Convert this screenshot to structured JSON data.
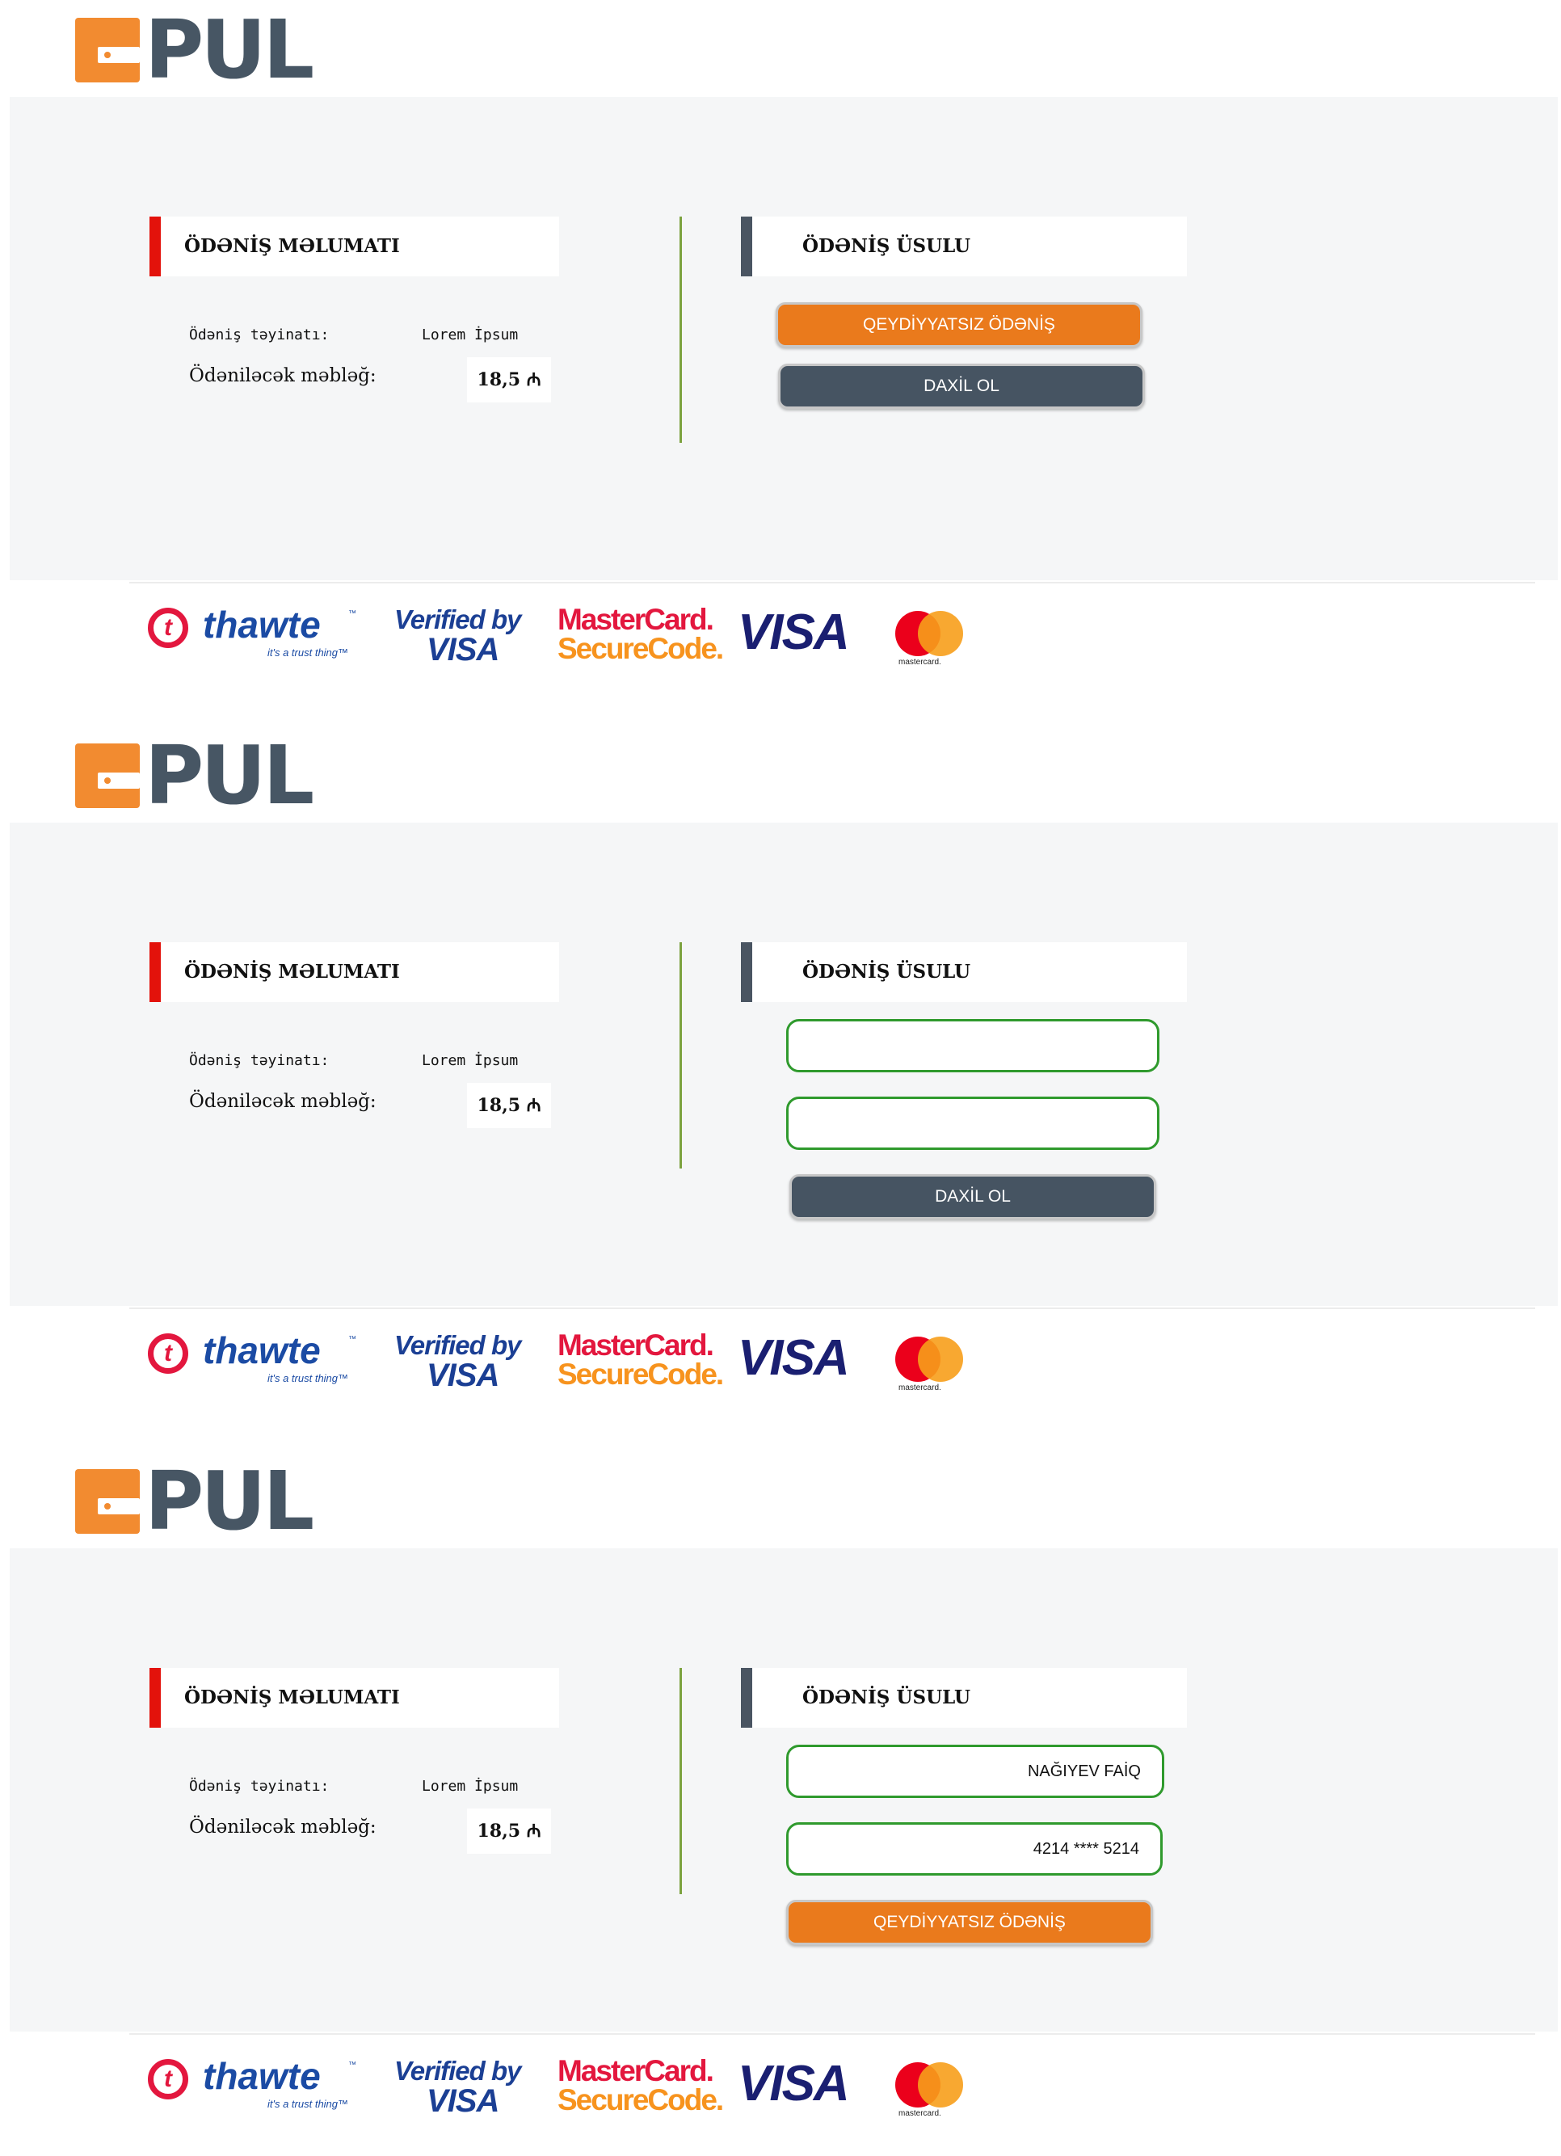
{
  "brand": {
    "logo_text": "PUL",
    "accent": "#f28b30",
    "dark": "#475664"
  },
  "payment_info": {
    "title": "ÖDƏNİŞ MƏLUMATI",
    "purpose_label": "Ödəniş təyinatı:",
    "purpose_value": "Lorem İpsum",
    "amount_label": "Ödəniləcək məbləğ:",
    "amount_value": "18,5 ₼"
  },
  "payment_method": {
    "title": "ÖDƏNİŞ ÜSULU"
  },
  "buttons": {
    "guest_pay": "QEYDİYYATSIZ ÖDƏNİŞ",
    "login": "DAXİL OL"
  },
  "filled_form": {
    "name": "NAĞIYEV FAİQ",
    "card": "4214 **** 5214"
  },
  "badges": {
    "thawte_letter": "t",
    "thawte": "thawte",
    "thawte_tm": "™",
    "thawte_tagline": "it's a trust thing™",
    "verified_line1": "Verified by",
    "verified_line2": "VISA",
    "mc_securecode_line1": "MasterCard.",
    "mc_securecode_line2": "SecureCode.",
    "visa": "VISA",
    "mastercard": "mastercard."
  },
  "colors": {
    "red_bar": "#e3120b",
    "slate_bar": "#4a5562",
    "green_divider": "#7ca23f",
    "field_border": "#2f9a2d",
    "orange_button": "#ea7a1c",
    "dark_button": "#465462"
  }
}
